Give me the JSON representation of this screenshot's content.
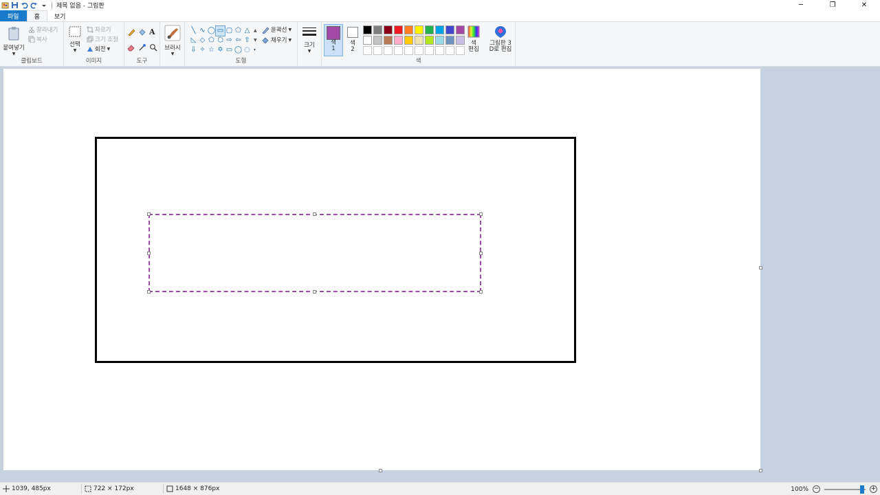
{
  "window": {
    "title": "제목 없음 - 그림판",
    "controls": [
      "─",
      "❐",
      "✕"
    ]
  },
  "tabs": [
    {
      "label": "파일"
    },
    {
      "label": "홈"
    },
    {
      "label": "보기"
    }
  ],
  "ribbon": {
    "clipboard": {
      "paste": "붙여넣기",
      "cut": "잘라내기",
      "copy": "복사",
      "group": "클립보드"
    },
    "image": {
      "select": "선택",
      "crop": "자르기",
      "resize": "크기 조정",
      "rotate": "회전",
      "group": "이미지"
    },
    "tools": {
      "group": "도구"
    },
    "brushes": {
      "label": "브러시"
    },
    "shapes": {
      "outline": "윤곽선",
      "fill": "채우기",
      "group": "도형"
    },
    "size": {
      "label": "크기"
    },
    "colors": {
      "color1": "색\n1",
      "color1_value": "#a24aa8",
      "color2": "색\n2",
      "color2_value": "#ffffff",
      "edit": "색\n편집",
      "group": "색",
      "palette": [
        "#000000",
        "#7f7f7f",
        "#880015",
        "#ed1c24",
        "#ff7f27",
        "#fff200",
        "#22b14c",
        "#00a2e8",
        "#3f48cc",
        "#a349a4",
        "#ffffff",
        "#c3c3c3",
        "#b97a57",
        "#ffaec9",
        "#ffc90e",
        "#efe4b0",
        "#b5e61d",
        "#99d9ea",
        "#7092be",
        "#c8bfe7",
        "#ffffff",
        "#ffffff",
        "#ffffff",
        "#ffffff",
        "#ffffff",
        "#ffffff",
        "#ffffff",
        "#ffffff",
        "#ffffff",
        "#ffffff"
      ]
    },
    "paint3d": {
      "label": "그림판 3\nD로 편집"
    }
  },
  "status": {
    "cursor": "1039, 485px",
    "selection": "722 × 172px",
    "canvas_size": "1648 × 876px",
    "zoom": "100%",
    "zoom_level": 100
  }
}
